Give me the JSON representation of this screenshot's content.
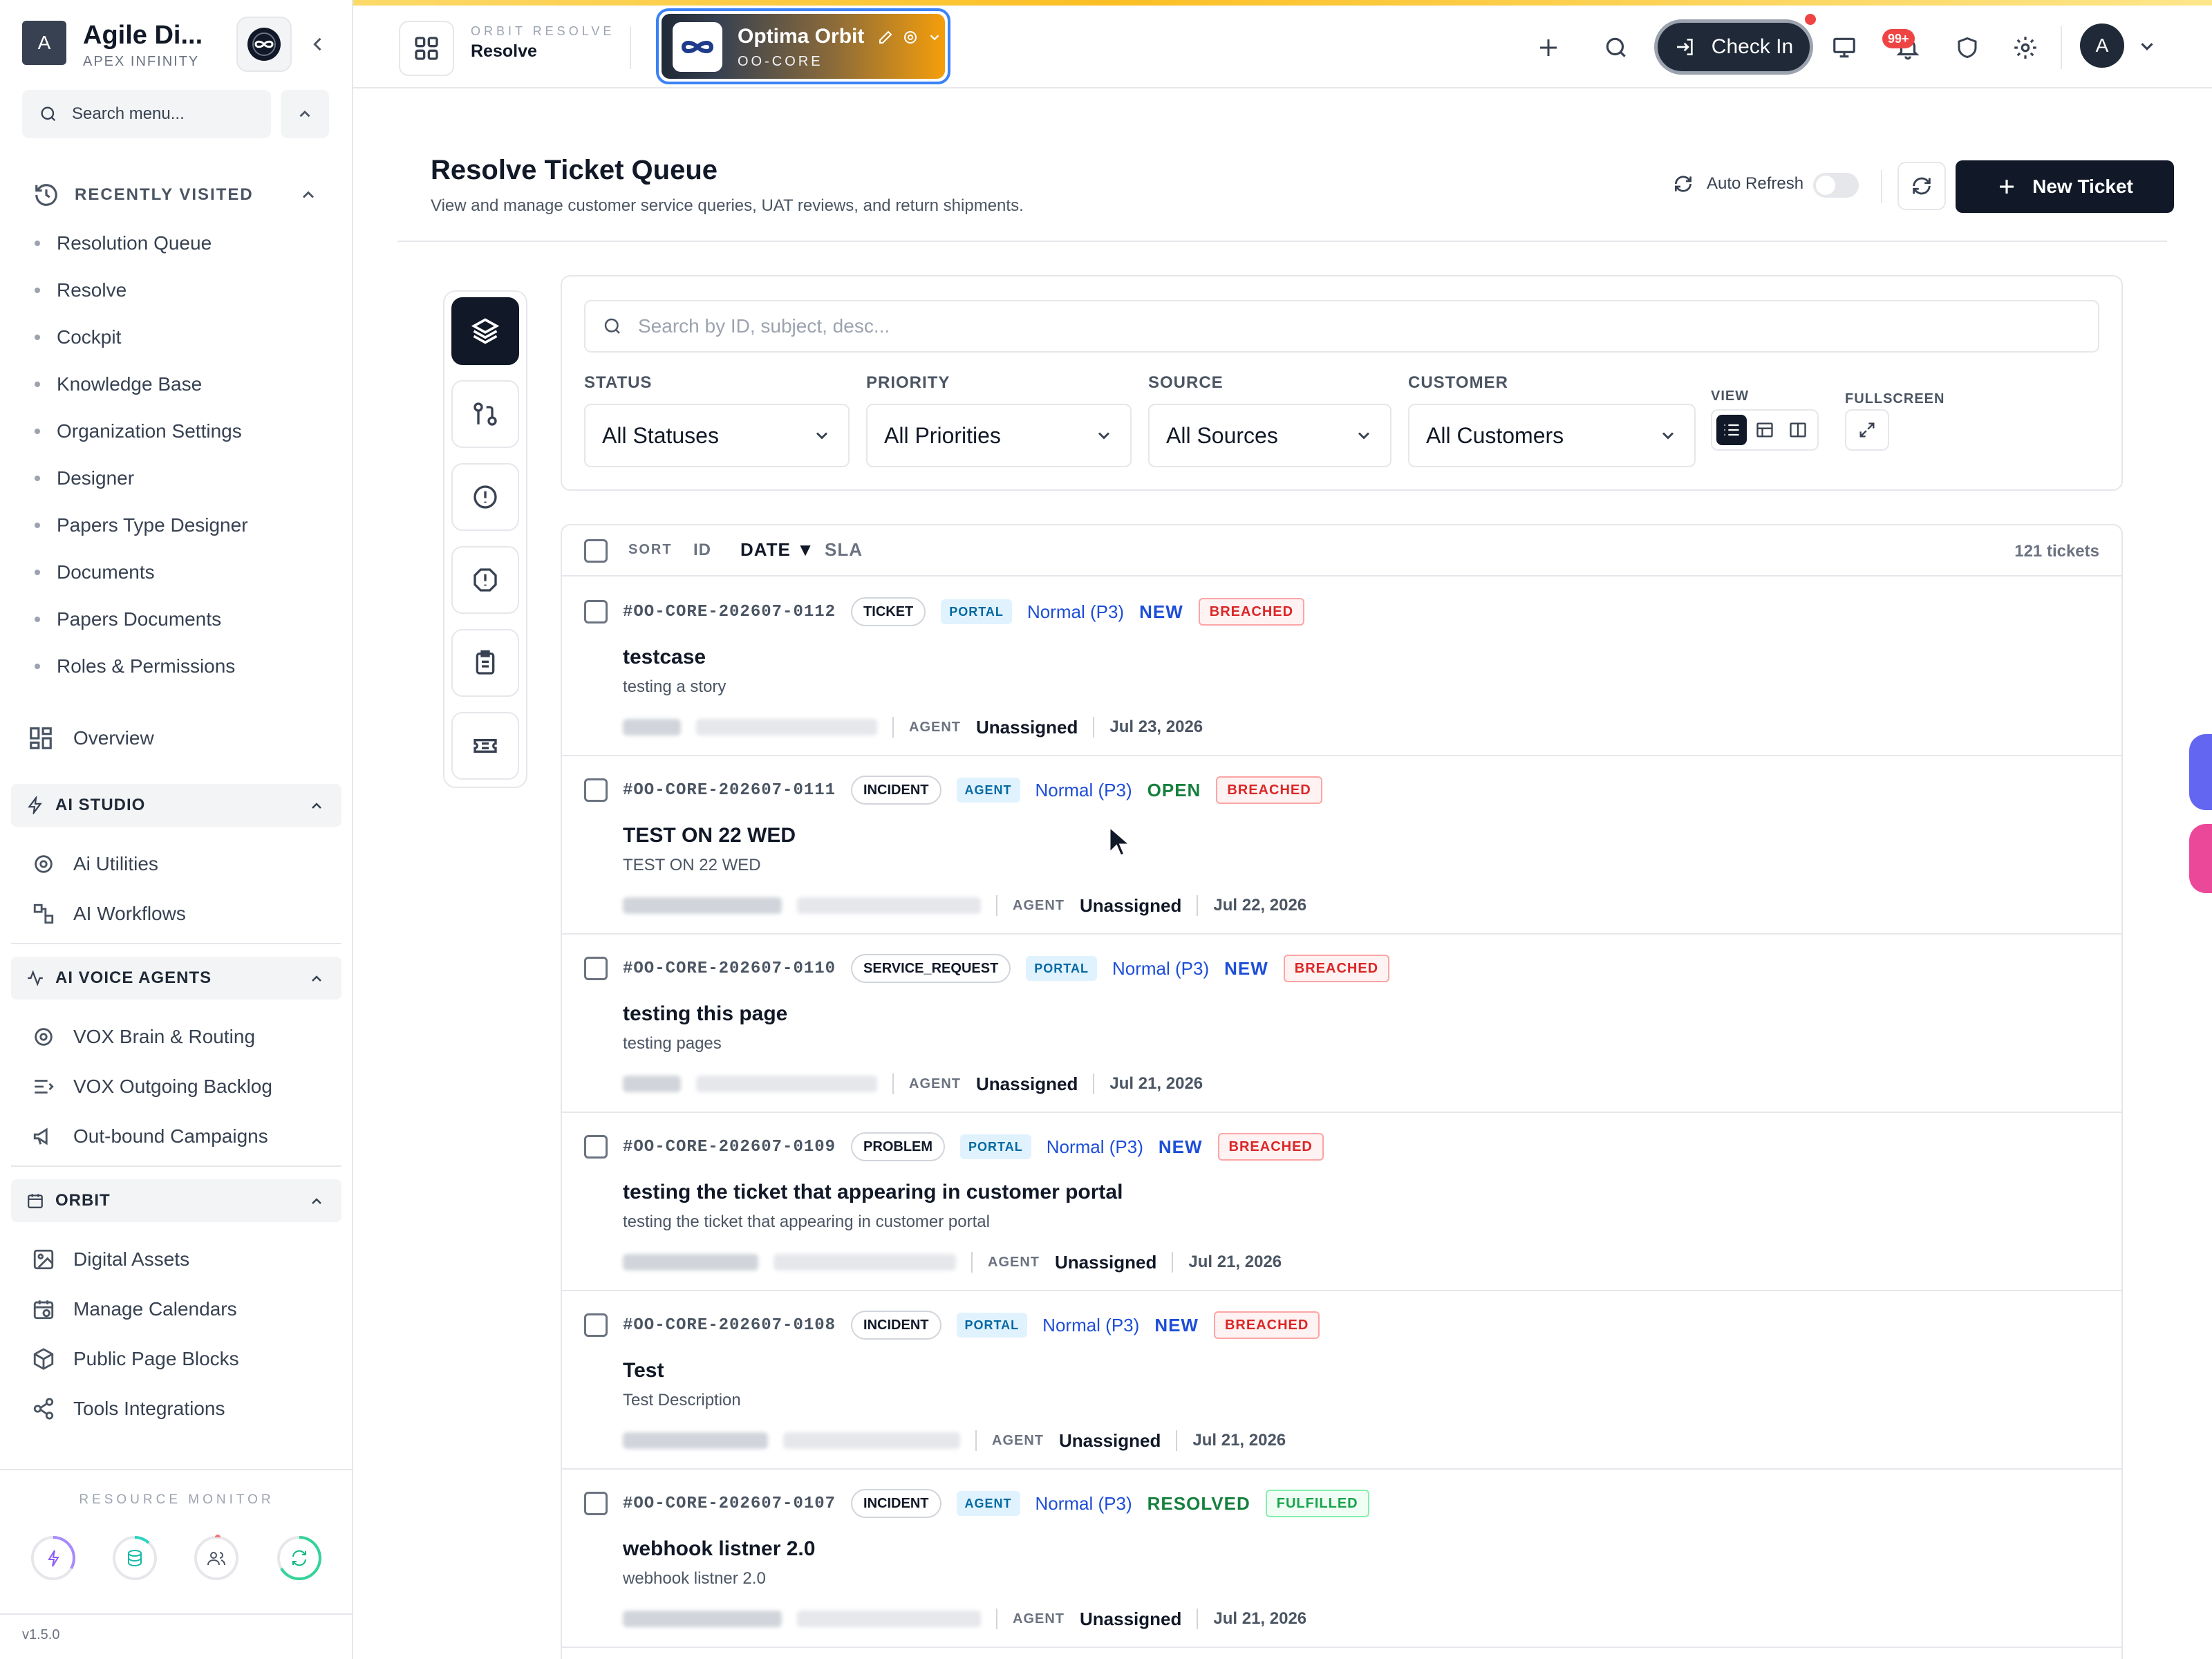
{
  "sidebar": {
    "brand_initial": "A",
    "brand_name": "Agile Di...",
    "brand_sub": "APEX INFINITY",
    "search_placeholder": "Search menu...",
    "recently_visited_label": "RECENTLY VISITED",
    "recent_items": [
      {
        "label": "Resolution Queue"
      },
      {
        "label": "Resolve"
      },
      {
        "label": "Cockpit"
      },
      {
        "label": "Knowledge Base"
      },
      {
        "label": "Organization Settings"
      },
      {
        "label": "Designer"
      },
      {
        "label": "Papers Type Designer"
      },
      {
        "label": "Documents"
      },
      {
        "label": "Papers Documents"
      },
      {
        "label": "Roles & Permissions"
      }
    ],
    "overview_label": "Overview",
    "sections": {
      "ai_studio": {
        "label": "AI STUDIO",
        "items": [
          {
            "label": "Ai Utilities",
            "icon": "gear-icon"
          },
          {
            "label": "AI Workflows",
            "icon": "workflow-icon"
          }
        ]
      },
      "ai_voice": {
        "label": "AI VOICE AGENTS",
        "items": [
          {
            "label": "VOX Brain & Routing",
            "icon": "gear-icon"
          },
          {
            "label": "VOX Outgoing Backlog",
            "icon": "list-icon"
          },
          {
            "label": "Out-bound Campaigns",
            "icon": "megaphone-icon"
          }
        ]
      },
      "orbit": {
        "label": "ORBIT",
        "items": [
          {
            "label": "Digital Assets",
            "icon": "image-icon"
          },
          {
            "label": "Manage Calendars",
            "icon": "calendar-icon"
          },
          {
            "label": "Public Page Blocks",
            "icon": "cube-icon"
          },
          {
            "label": "Tools Integrations",
            "icon": "share-icon"
          }
        ]
      }
    },
    "resource_monitor_label": "RESOURCE MONITOR",
    "version": "v1.5.0"
  },
  "topbar": {
    "module_label": "ORBIT RESOLVE",
    "module_value": "Resolve",
    "tenant_name": "Optima Orbit",
    "tenant_code": "OO-CORE",
    "checkin_label": "Check In",
    "notification_badge": "99+",
    "avatar_initial": "A"
  },
  "page": {
    "title": "Resolve Ticket Queue",
    "subtitle": "View and manage customer service queries, UAT reviews, and return shipments.",
    "auto_refresh_label": "Auto Refresh",
    "new_ticket_label": "New Ticket"
  },
  "filters": {
    "search_placeholder": "Search by ID, subject, desc...",
    "status_label": "STATUS",
    "status_value": "All Statuses",
    "priority_label": "PRIORITY",
    "priority_value": "All Priorities",
    "source_label": "SOURCE",
    "source_value": "All Sources",
    "customer_label": "CUSTOMER",
    "customer_value": "All Customers",
    "view_label": "VIEW",
    "fullscreen_label": "FULLSCREEN"
  },
  "list": {
    "sort_label": "SORT",
    "sort_id": "ID",
    "sort_date": "DATE ▼",
    "sort_sla": "SLA",
    "count": "121 tickets",
    "agent_label": "AGENT",
    "tickets": [
      {
        "id": "#OO-CORE-202607-0112",
        "type": "TICKET",
        "source": "PORTAL",
        "priority": "Normal (P3)",
        "status": "NEW",
        "status_color": "#1d4ed8",
        "sla": "BREACHED",
        "subject": "testcase",
        "description": "testing a story",
        "agent": "Unassigned",
        "date": "Jul 23, 2026"
      },
      {
        "id": "#OO-CORE-202607-0111",
        "type": "INCIDENT",
        "source": "AGENT",
        "priority": "Normal (P3)",
        "status": "OPEN",
        "status_color": "#15803d",
        "sla": "BREACHED",
        "subject": "TEST ON 22 WED",
        "description": "TEST ON 22 WED",
        "agent": "Unassigned",
        "date": "Jul 22, 2026"
      },
      {
        "id": "#OO-CORE-202607-0110",
        "type": "SERVICE_REQUEST",
        "source": "PORTAL",
        "priority": "Normal (P3)",
        "status": "NEW",
        "status_color": "#1d4ed8",
        "sla": "BREACHED",
        "subject": "testing this page",
        "description": "testing pages",
        "agent": "Unassigned",
        "date": "Jul 21, 2026"
      },
      {
        "id": "#OO-CORE-202607-0109",
        "type": "PROBLEM",
        "source": "PORTAL",
        "priority": "Normal (P3)",
        "status": "NEW",
        "status_color": "#1d4ed8",
        "sla": "BREACHED",
        "subject": "testing the ticket that appearing in customer portal",
        "description": "testing the ticket that appearing in customer portal",
        "agent": "Unassigned",
        "date": "Jul 21, 2026"
      },
      {
        "id": "#OO-CORE-202607-0108",
        "type": "INCIDENT",
        "source": "PORTAL",
        "priority": "Normal (P3)",
        "status": "NEW",
        "status_color": "#1d4ed8",
        "sla": "BREACHED",
        "subject": "Test",
        "description": "Test Description",
        "agent": "Unassigned",
        "date": "Jul 21, 2026"
      },
      {
        "id": "#OO-CORE-202607-0107",
        "type": "INCIDENT",
        "source": "AGENT",
        "priority": "Normal (P3)",
        "status": "RESOLVED",
        "status_color": "#15803d",
        "sla": "FULFILLED",
        "subject": "webhook listner 2.0",
        "description": "webhook listner 2.0",
        "agent": "Unassigned",
        "date": "Jul 21, 2026"
      }
    ]
  }
}
